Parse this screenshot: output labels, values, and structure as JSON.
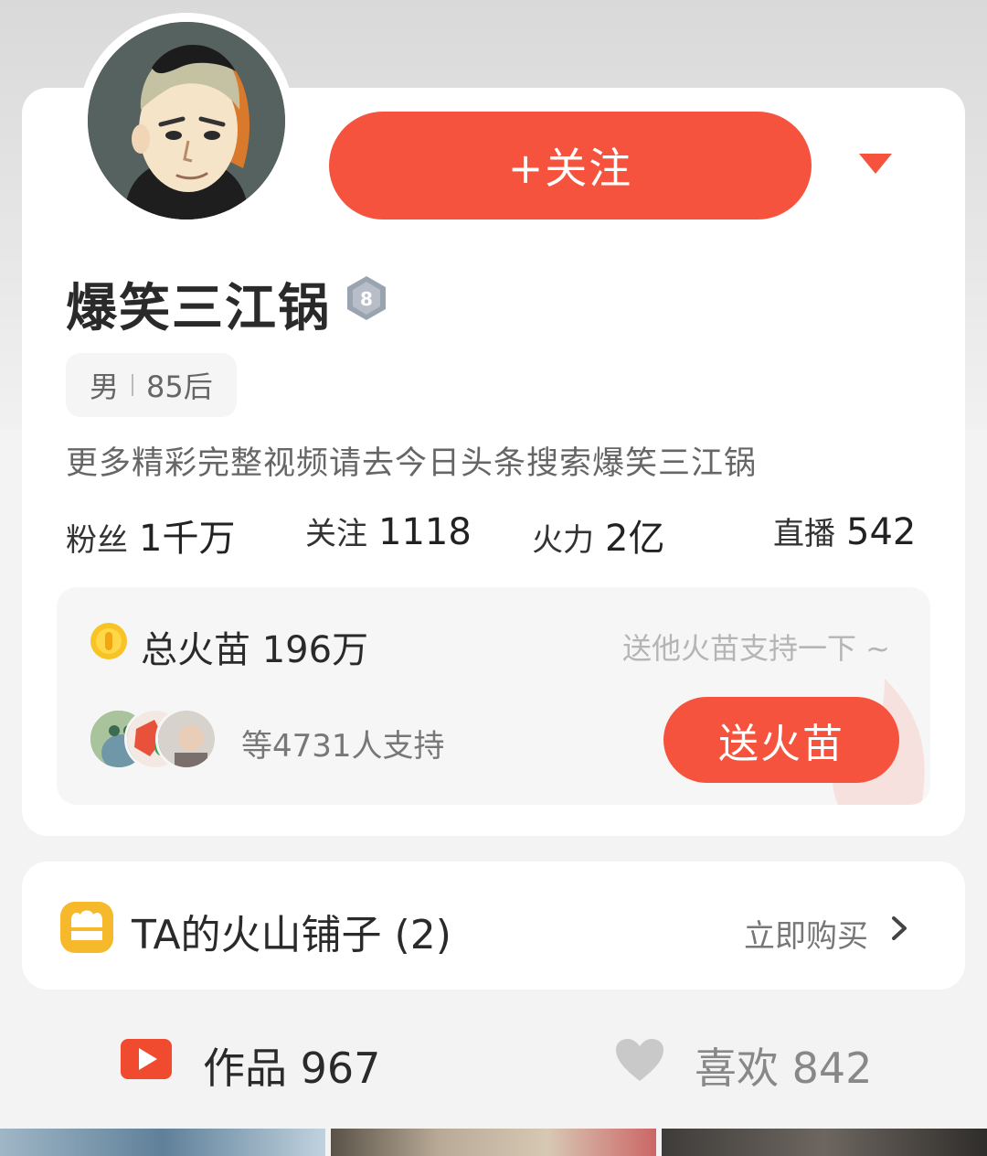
{
  "profile": {
    "follow_button": "+关注",
    "name": "爆笑三江锅",
    "level": "8",
    "gender": "男",
    "age_group": "85后",
    "bio": "更多精彩完整视频请去今日头条搜索爆笑三江锅"
  },
  "stats": [
    {
      "label": "粉丝",
      "value": "1千万"
    },
    {
      "label": "关注",
      "value": "1118"
    },
    {
      "label": "火力",
      "value": "2亿"
    },
    {
      "label": "直播",
      "value": "542"
    }
  ],
  "support": {
    "total_label": "总火苗",
    "total_value": "196万",
    "hint": "送他火苗支持一下 ~",
    "supporter_count": "等4731人支持",
    "send_button": "送火苗"
  },
  "shop": {
    "title": "TA的火山铺子 (2)",
    "action": "立即购买"
  },
  "tabs": {
    "works_label": "作品",
    "works_count": "967",
    "likes_label": "喜欢",
    "likes_count": "842"
  },
  "colors": {
    "accent": "#f5533d",
    "shop_icon": "#f7b92c",
    "coin": "#f7c325",
    "works_icon": "#f04b2f"
  },
  "icons": {
    "dropdown": "caret-down-icon",
    "level": "hexagon-badge-icon",
    "coin": "coin-icon",
    "shop": "shop-icon",
    "chevron": "chevron-right-icon",
    "works": "play-icon",
    "likes": "heart-icon"
  }
}
